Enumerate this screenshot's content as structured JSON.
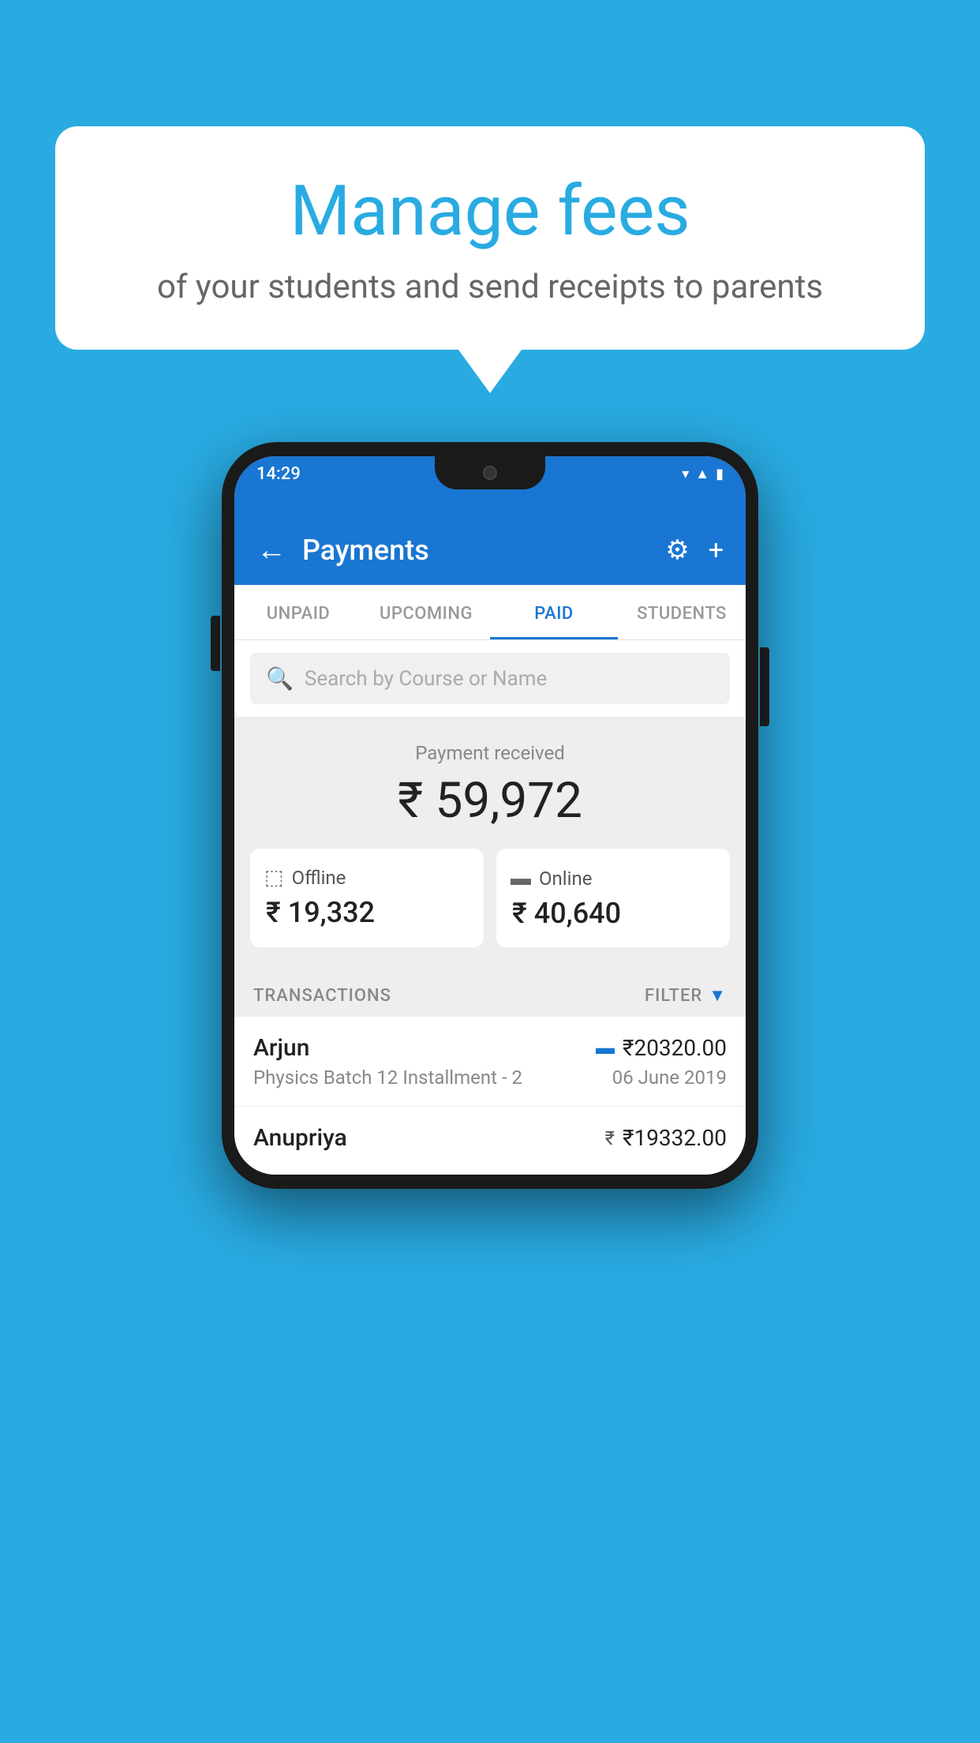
{
  "background_color": "#29abe2",
  "speech_bubble": {
    "title": "Manage fees",
    "subtitle": "of your students and send receipts to parents"
  },
  "phone": {
    "status_bar": {
      "time": "14:29",
      "icons": [
        "wifi",
        "signal",
        "battery"
      ]
    },
    "app_bar": {
      "back_icon": "←",
      "title": "Payments",
      "settings_icon": "⚙",
      "add_icon": "+"
    },
    "tabs": [
      {
        "label": "UNPAID",
        "active": false
      },
      {
        "label": "UPCOMING",
        "active": false
      },
      {
        "label": "PAID",
        "active": true
      },
      {
        "label": "STUDENTS",
        "active": false
      }
    ],
    "search": {
      "placeholder": "Search by Course or Name",
      "search_icon": "🔍"
    },
    "payment_section": {
      "label": "Payment received",
      "amount": "₹ 59,972",
      "offline": {
        "type": "Offline",
        "amount": "₹ 19,332"
      },
      "online": {
        "type": "Online",
        "amount": "₹ 40,640"
      }
    },
    "transactions": {
      "label": "TRANSACTIONS",
      "filter_label": "FILTER",
      "items": [
        {
          "name": "Arjun",
          "payment_type": "card",
          "amount": "₹20320.00",
          "course": "Physics Batch 12 Installment - 2",
          "date": "06 June 2019"
        },
        {
          "name": "Anupriya",
          "payment_type": "cash",
          "amount": "₹19332.00",
          "course": "",
          "date": ""
        }
      ]
    }
  }
}
